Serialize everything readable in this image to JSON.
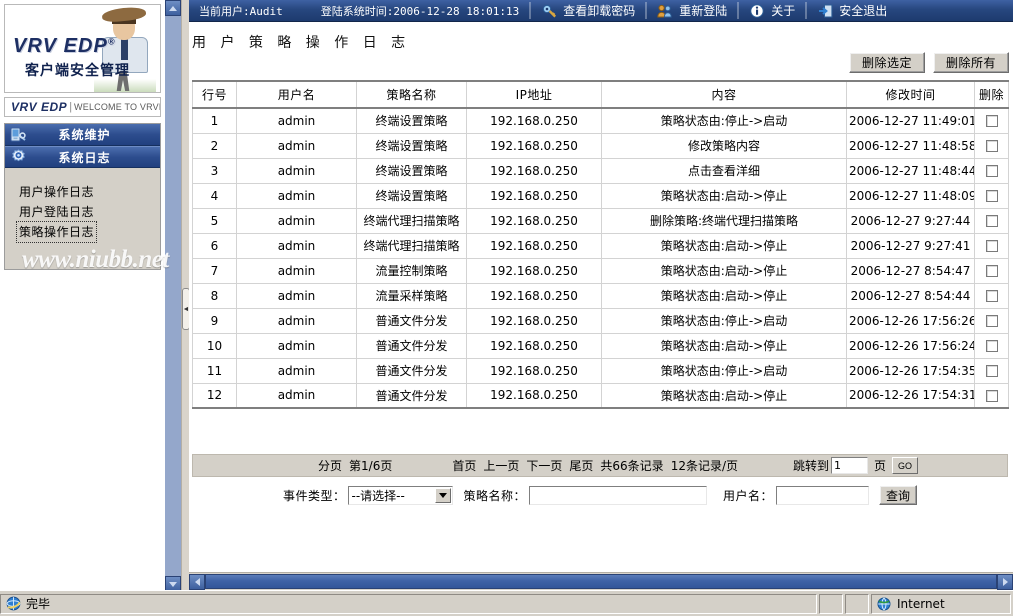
{
  "topbar": {
    "current_user": "当前用户:Audit",
    "login_time": "登陆系统时间:2006-12-28 18:01:13",
    "view_uninstall_password": "查看卸载密码",
    "relogin": "重新登陆",
    "about": "关于",
    "logout": "安全退出",
    "icons": {
      "key": "key-icon",
      "users": "users-icon",
      "info": "info-icon",
      "exit": "exit-door-icon"
    }
  },
  "sidebar": {
    "logo": {
      "brand": "VRV EDP",
      "registered": "®",
      "subtitle": "客户端安全管理"
    },
    "welcome": {
      "brand": "VRV EDP",
      "separator": "|",
      "text": "WELCOME TO VRVEDP"
    },
    "menu_headers": [
      {
        "label": "系统维护",
        "icon": "maintenance-icon"
      },
      {
        "label": "系统日志",
        "icon": "log-gear-icon"
      }
    ],
    "submenu": [
      {
        "label": "用户操作日志",
        "active": false
      },
      {
        "label": "用户登陆日志",
        "active": false
      },
      {
        "label": "策略操作日志",
        "active": true
      }
    ]
  },
  "watermark": "www.niubb.net",
  "main": {
    "page_title": "用 户 策 略 操 作 日 志",
    "buttons": {
      "delete_selected": "删除选定",
      "delete_all": "删除所有"
    },
    "table": {
      "columns": [
        "行号",
        "用户名",
        "策略名称",
        "IP地址",
        "内容",
        "修改时间",
        "删除"
      ],
      "rows": [
        {
          "no": "1",
          "user": "admin",
          "policy": "终端设置策略",
          "ip": "192.168.0.250",
          "content": "策略状态由:停止->启动",
          "time": "2006-12-27 11:49:01"
        },
        {
          "no": "2",
          "user": "admin",
          "policy": "终端设置策略",
          "ip": "192.168.0.250",
          "content": "修改策略内容",
          "time": "2006-12-27 11:48:58"
        },
        {
          "no": "3",
          "user": "admin",
          "policy": "终端设置策略",
          "ip": "192.168.0.250",
          "content": "点击查看洋细",
          "time": "2006-12-27 11:48:44"
        },
        {
          "no": "4",
          "user": "admin",
          "policy": "终端设置策略",
          "ip": "192.168.0.250",
          "content": "策略状态由:启动->停止",
          "time": "2006-12-27 11:48:09"
        },
        {
          "no": "5",
          "user": "admin",
          "policy": "终端代理扫描策略",
          "ip": "192.168.0.250",
          "content": "删除策略:终端代理扫描策略",
          "time": "2006-12-27 9:27:44"
        },
        {
          "no": "6",
          "user": "admin",
          "policy": "终端代理扫描策略",
          "ip": "192.168.0.250",
          "content": "策略状态由:启动->停止",
          "time": "2006-12-27 9:27:41"
        },
        {
          "no": "7",
          "user": "admin",
          "policy": "流量控制策略",
          "ip": "192.168.0.250",
          "content": "策略状态由:启动->停止",
          "time": "2006-12-27 8:54:47"
        },
        {
          "no": "8",
          "user": "admin",
          "policy": "流量采样策略",
          "ip": "192.168.0.250",
          "content": "策略状态由:启动->停止",
          "time": "2006-12-27 8:54:44"
        },
        {
          "no": "9",
          "user": "admin",
          "policy": "普通文件分发",
          "ip": "192.168.0.250",
          "content": "策略状态由:停止->启动",
          "time": "2006-12-26 17:56:26"
        },
        {
          "no": "10",
          "user": "admin",
          "policy": "普通文件分发",
          "ip": "192.168.0.250",
          "content": "策略状态由:启动->停止",
          "time": "2006-12-26 17:56:24"
        },
        {
          "no": "11",
          "user": "admin",
          "policy": "普通文件分发",
          "ip": "192.168.0.250",
          "content": "策略状态由:停止->启动",
          "time": "2006-12-26 17:54:35"
        },
        {
          "no": "12",
          "user": "admin",
          "policy": "普通文件分发",
          "ip": "192.168.0.250",
          "content": "策略状态由:启动->停止",
          "time": "2006-12-26 17:54:31"
        }
      ]
    },
    "pager": {
      "label": "分页",
      "page_of": "第1/6页",
      "first": "首页",
      "prev": "上一页",
      "next": "下一页",
      "last": "尾页",
      "total": "共66条记录",
      "per_page": "12条记录/页",
      "jump_label": "跳转到",
      "jump_value": "1",
      "page_unit": "页",
      "go": "GO"
    },
    "search": {
      "event_type_label": "事件类型：",
      "event_type_value": "--请选择--",
      "policy_name_label": "策略名称：",
      "policy_name_value": "",
      "user_name_label": "用户名：",
      "user_name_value": "",
      "submit": "查询"
    }
  },
  "statusbar": {
    "message": "完毕",
    "zone": "Internet"
  }
}
